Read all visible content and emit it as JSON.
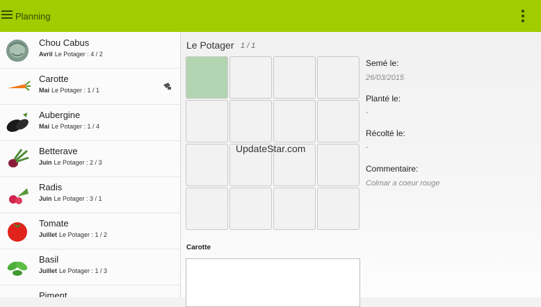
{
  "appbar": {
    "title": "Planning",
    "menu_icon": "hamburger-icon",
    "overflow_icon": "vertical-dots-icon",
    "color": "#a0cc00"
  },
  "vegetables": [
    {
      "name": "Chou Cabus",
      "month": "Avril",
      "location": "Le Potager : 4 / 2",
      "icon": "cabbage-icon"
    },
    {
      "name": "Carotte",
      "month": "Mai",
      "location": "Le Potager : 1 / 1",
      "icon": "carrot-icon"
    },
    {
      "name": "Aubergine",
      "month": "Mai",
      "location": "Le Potager : 1 / 4",
      "icon": "eggplant-icon"
    },
    {
      "name": "Betterave",
      "month": "Juin",
      "location": "Le Potager : 2 / 3",
      "icon": "beet-icon"
    },
    {
      "name": "Radis",
      "month": "Juin",
      "location": "Le Potager : 3 / 1",
      "icon": "radish-icon"
    },
    {
      "name": "Tomate",
      "month": "Juillet",
      "location": "Le Potager : 1 / 2",
      "icon": "tomato-icon"
    },
    {
      "name": "Basil",
      "month": "Juillet",
      "location": "Le Potager : 1 / 3",
      "icon": "basil-icon"
    },
    {
      "name": "Piment",
      "month": "",
      "location": "",
      "icon": "pepper-icon"
    }
  ],
  "main": {
    "garden_title": "Le Potager",
    "garden_page": "1 / 1",
    "watermark": "UpdateStar.com",
    "selected_name": "Carotte",
    "filled_color": "#b3d4b1"
  },
  "details": {
    "sown_label": "Semé le:",
    "sown_value": "26/03/2015",
    "planted_label": "Planté le:",
    "planted_value": "-",
    "harvested_label": "Récolté le:",
    "harvested_value": "-",
    "comment_label": "Commentaire:",
    "comment_value": "Colmar a coeur rouge"
  }
}
